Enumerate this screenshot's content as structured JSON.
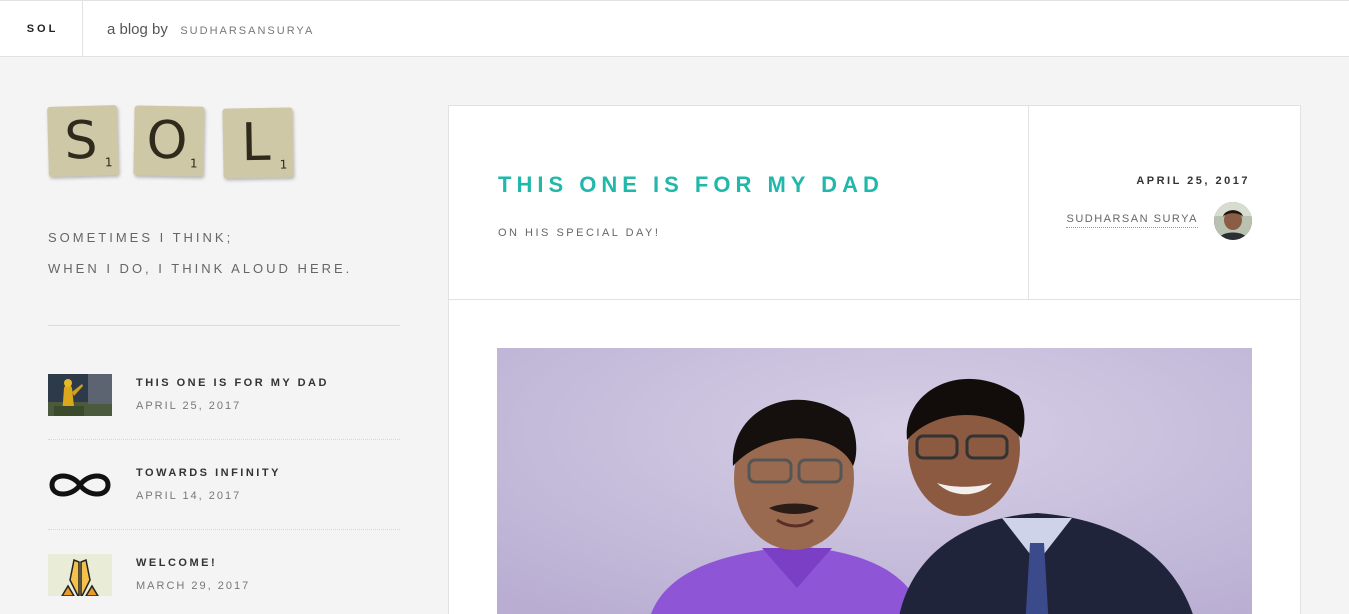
{
  "topbar": {
    "brand": "SOL",
    "byline_prefix": "a blog by",
    "byline_author": "SUDHARSANSURYA"
  },
  "sidebar": {
    "logo_tiles": [
      {
        "letter": "S",
        "score": "1"
      },
      {
        "letter": "O",
        "score": "1"
      },
      {
        "letter": "L",
        "score": "1"
      }
    ],
    "tagline": [
      "SOMETIMES I THINK;",
      "WHEN I DO, I THINK ALOUD HERE."
    ],
    "recent_posts": [
      {
        "title": "THIS ONE IS FOR MY DAD",
        "date": "APRIL 25, 2017",
        "thumb": "statue-thumbnail"
      },
      {
        "title": "TOWARDS INFINITY",
        "date": "APRIL 14, 2017",
        "thumb": "infinity-icon"
      },
      {
        "title": "WELCOME!",
        "date": "MARCH 29, 2017",
        "thumb": "folded-hands-icon"
      }
    ]
  },
  "post": {
    "title": "THIS ONE IS FOR MY DAD",
    "subtitle": "ON HIS SPECIAL DAY!",
    "date": "APRIL 25, 2017",
    "author": "SUDHARSAN SURYA",
    "hero_image": "father-and-son-photo"
  },
  "colors": {
    "accent": "#1fb8aa",
    "page_bg": "#f4f4f4",
    "tile": "#cfc8a7",
    "hero_bg": "#c9c0de"
  }
}
